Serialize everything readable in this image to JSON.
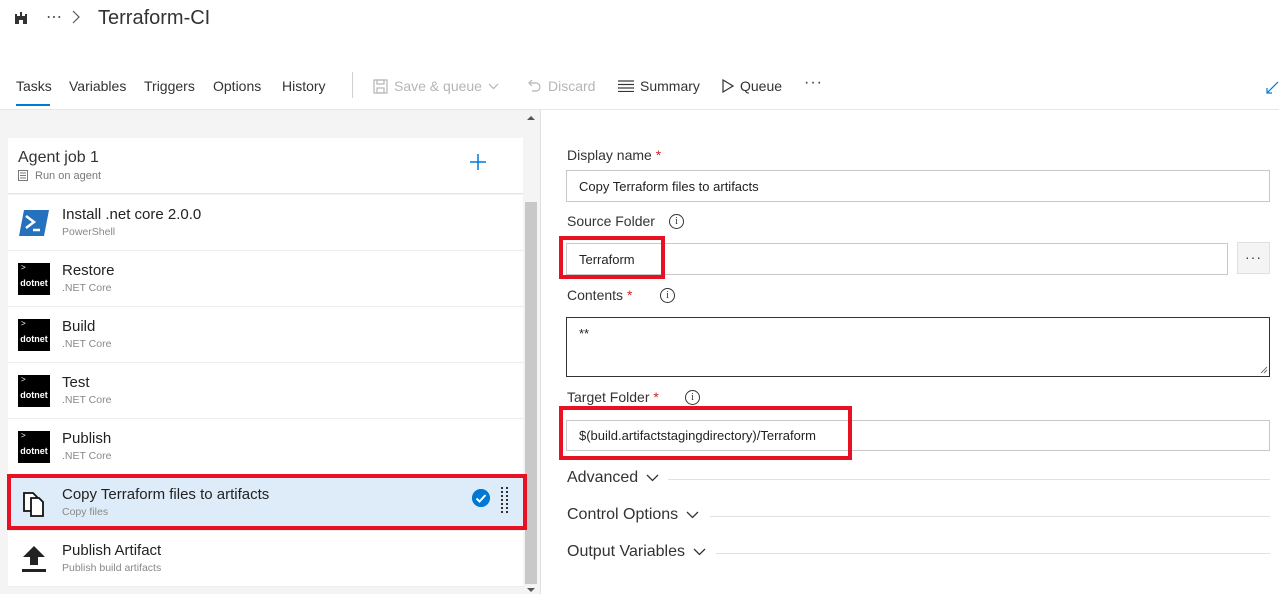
{
  "header": {
    "org_icon": "castle-icon",
    "more": "⋯",
    "title": "Terraform-CI"
  },
  "tabs": [
    {
      "label": "Tasks",
      "active": true
    },
    {
      "label": "Variables"
    },
    {
      "label": "Triggers"
    },
    {
      "label": "Options"
    },
    {
      "label": "History"
    }
  ],
  "toolbar": {
    "save_queue": "Save & queue",
    "discard": "Discard",
    "summary": "Summary",
    "queue": "Queue",
    "more": "···"
  },
  "job": {
    "title": "Agent job 1",
    "subtitle": "Run on agent"
  },
  "tasks": [
    {
      "name": "Install .net core 2.0.0",
      "type": "PowerShell",
      "icon": "powershell-icon"
    },
    {
      "name": "Restore",
      "type": ".NET Core",
      "icon": "dotnet-icon"
    },
    {
      "name": "Build",
      "type": ".NET Core",
      "icon": "dotnet-icon"
    },
    {
      "name": "Test",
      "type": ".NET Core",
      "icon": "dotnet-icon"
    },
    {
      "name": "Publish",
      "type": ".NET Core",
      "icon": "dotnet-icon"
    },
    {
      "name": "Copy Terraform files to artifacts",
      "type": "Copy files",
      "icon": "copy-files-icon",
      "selected": true
    },
    {
      "name": "Publish Artifact",
      "type": "Publish build artifacts",
      "icon": "upload-icon"
    }
  ],
  "dotnet_badge": "dotnet",
  "form": {
    "display_name_label": "Display name",
    "display_name_value": "Copy Terraform files to artifacts",
    "source_folder_label": "Source Folder",
    "source_folder_value": "Terraform",
    "browse": "···",
    "contents_label": "Contents",
    "contents_value": "**",
    "target_folder_label": "Target Folder",
    "target_folder_value": "$(build.artifactstagingdirectory)/Terraform",
    "required_mark": "*",
    "info_glyph": "i"
  },
  "sections": {
    "advanced": "Advanced",
    "control_options": "Control Options",
    "output_variables": "Output Variables"
  },
  "colors": {
    "accent": "#0078d4",
    "highlight_box": "#e81123",
    "selected_row": "#deecf9"
  }
}
